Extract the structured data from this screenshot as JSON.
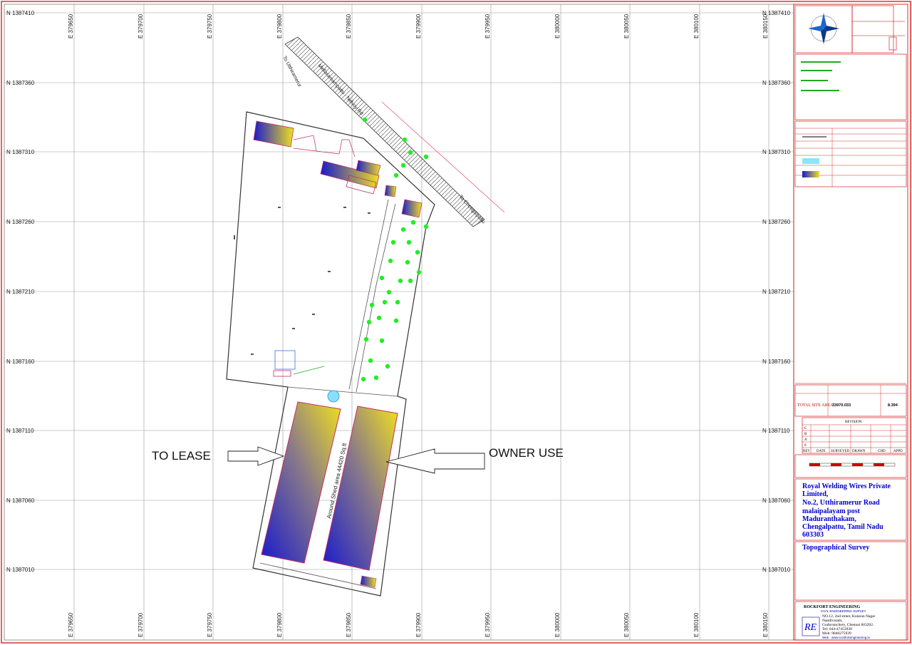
{
  "grid": {
    "easting_labels": [
      "E 379650",
      "E 379700",
      "E 379750",
      "E 379800",
      "E 379850",
      "E 379900",
      "E 379950",
      "E 380000",
      "E 380050",
      "E 380100",
      "E 380150"
    ],
    "northing_labels": [
      "N 1387410",
      "N 1387360",
      "N 1387310",
      "N 1387260",
      "N 1387210",
      "N 1387160",
      "N 1387110",
      "N 1387060",
      "N 1387010"
    ]
  },
  "annotations": {
    "to_lease": "TO LEASE",
    "owner_use": "OWNER USE"
  },
  "map_labels": {
    "road_name": "Mellaramampattu - Nelvoy Rd",
    "to_utthiramerur": "To Utthiramerur",
    "to_chengalpattu": "To Chengalpattu",
    "shed_area": "Around Shed area 44420 Sq.ft"
  },
  "title_block": {
    "total_site_area_label": "TOTAL SITE AREA",
    "total_site_area_sqft": "33970.033",
    "total_site_area_acres": "8.394",
    "revision_label": "REVISION",
    "revision_rows": [
      "C",
      "B",
      "A",
      "0"
    ],
    "revision_header": [
      "REV",
      "DATE",
      "SURVEYED",
      "DRAWN",
      "CHD",
      "APPD"
    ],
    "owner_lines": [
      "Royal Welding Wires Private",
      "Limited,",
      " No.2, Utthiramerur Road",
      "malaipalayam post",
      "Maduranthakam,",
      "Chengalpattu, Tamil Nadu",
      "603303"
    ],
    "drawing_title": "Topographical Survey",
    "company_name": "ROCKFORT ENGINEERING",
    "company_sub": "CIVIL ENGINEERING SURVEY",
    "company_address": [
      "NO.12, 2nd street, Kularan Nagar",
      "Nandivaram,",
      "Guduvanchery, Chennai 603202.",
      "Tel: 044-47453938",
      "Mob: 9840275939",
      "Web : www.rockfortengineering.in"
    ]
  },
  "colors": {
    "border": "#cc0000",
    "grid": "#999999",
    "boundary": "#333333",
    "building_start": "#1a1acc",
    "building_end": "#f0e020",
    "tree": "#22ee22",
    "annotation_blue": "#0000cc"
  }
}
